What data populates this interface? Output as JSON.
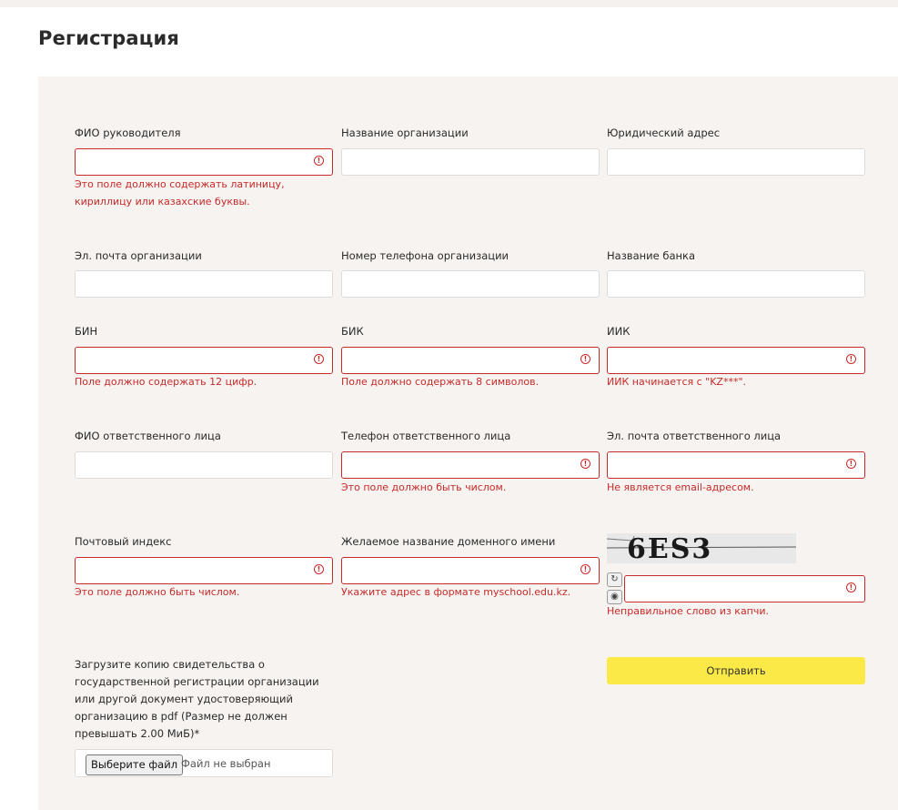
{
  "page": {
    "title": "Регистрация"
  },
  "form": {
    "fields": {
      "director_name": {
        "label": "ФИО руководителя",
        "value": "",
        "error": "Это поле должно содержать латиницу, кириллицу или казахские буквы."
      },
      "org_name": {
        "label": "Название организации",
        "value": ""
      },
      "legal_address": {
        "label": "Юридический адрес",
        "value": ""
      },
      "org_email": {
        "label": "Эл. почта организации",
        "value": ""
      },
      "org_phone": {
        "label": "Номер телефона организации",
        "value": ""
      },
      "bank_name": {
        "label": "Название банка",
        "value": ""
      },
      "bin": {
        "label": "БИН",
        "value": "",
        "error": "Поле должно содержать 12 цифр."
      },
      "bik": {
        "label": "БИК",
        "value": "",
        "error": "Поле должно содержать 8 символов."
      },
      "iik": {
        "label": "ИИК",
        "value": "",
        "error": "ИИК начинается с \"KZ***\"."
      },
      "contact_name": {
        "label": "ФИО ответственного лица",
        "value": ""
      },
      "contact_phone": {
        "label": "Телефон ответственного лица",
        "value": "",
        "error": "Это поле должно быть числом."
      },
      "contact_email": {
        "label": "Эл. почта ответственного лица",
        "value": "",
        "error": "Не является email-адресом."
      },
      "postal_code": {
        "label": "Почтовый индекс",
        "value": "",
        "error": "Это поле должно быть числом."
      },
      "domain_name": {
        "label": "Желаемое название доменного имени",
        "value": "",
        "error": "Укажите адрес в формате myschool.edu.kz."
      },
      "captcha": {
        "image_text": "6ES3",
        "value": "",
        "error": "Неправильное слово из капчи."
      }
    },
    "upload": {
      "label": "Загрузите копию свидетельства о государственной регистрации организации или другой документ удостоверяющий организацию в pdf (Размер не должен превышать 2.00 МиБ)*",
      "button_label": "Выберите файл",
      "status": "Файл не выбран"
    },
    "submit_label": "Отправить"
  },
  "icons": {
    "error": "exclamation-circle-icon",
    "refresh": "refresh-icon",
    "audio": "audio-icon"
  },
  "colors": {
    "error": "#c62a2a",
    "panel_bg": "#f6f3f0",
    "submit_bg": "#fbe947"
  }
}
